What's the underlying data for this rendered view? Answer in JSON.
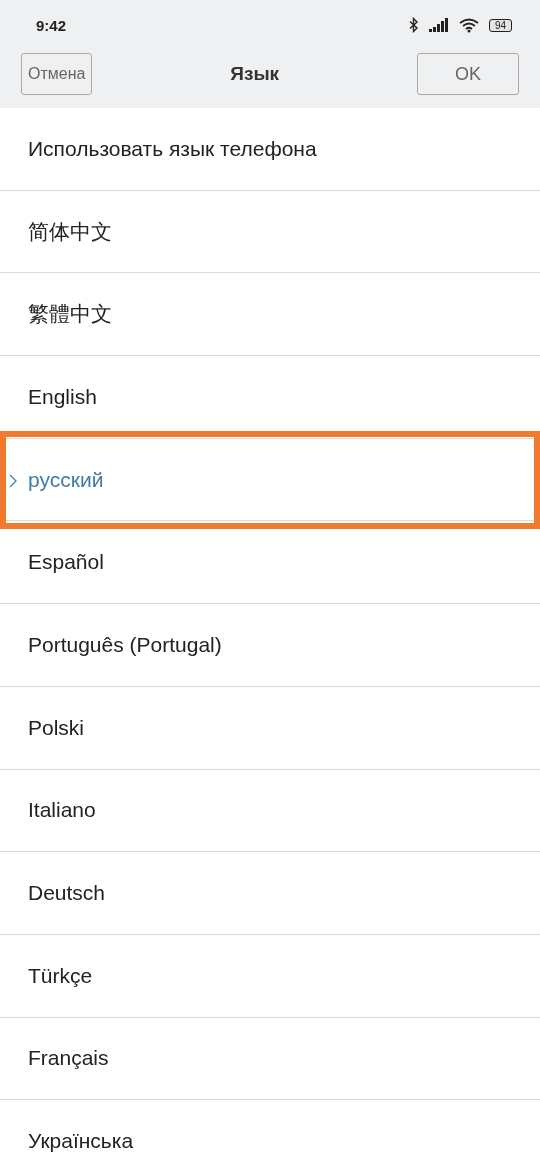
{
  "status_bar": {
    "time": "9:42",
    "battery": "94"
  },
  "header": {
    "cancel": "Отмена",
    "title": "Язык",
    "ok": "OK"
  },
  "languages": [
    {
      "label": "Использовать язык телефона",
      "selected": false,
      "highlighted": false
    },
    {
      "label": "简体中文",
      "selected": false,
      "highlighted": false
    },
    {
      "label": "繁體中文",
      "selected": false,
      "highlighted": false
    },
    {
      "label": "English",
      "selected": false,
      "highlighted": false
    },
    {
      "label": "русский",
      "selected": true,
      "highlighted": true
    },
    {
      "label": "Español",
      "selected": false,
      "highlighted": false
    },
    {
      "label": "Português (Portugal)",
      "selected": false,
      "highlighted": false
    },
    {
      "label": "Polski",
      "selected": false,
      "highlighted": false
    },
    {
      "label": "Italiano",
      "selected": false,
      "highlighted": false
    },
    {
      "label": "Deutsch",
      "selected": false,
      "highlighted": false
    },
    {
      "label": "Türkçe",
      "selected": false,
      "highlighted": false
    },
    {
      "label": "Français",
      "selected": false,
      "highlighted": false
    },
    {
      "label": "Українська",
      "selected": false,
      "highlighted": false
    }
  ]
}
